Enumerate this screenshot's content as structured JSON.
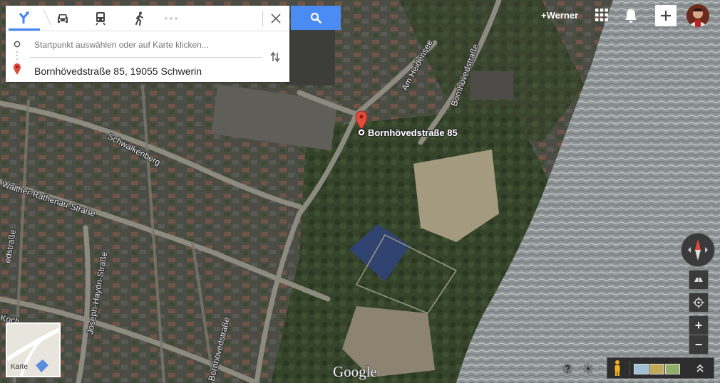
{
  "directions": {
    "modes": [
      {
        "name": "best-route",
        "icon": "route-arrow-icon",
        "active": true
      },
      {
        "name": "car",
        "icon": "car-icon",
        "active": false
      },
      {
        "name": "transit",
        "icon": "train-icon",
        "active": false
      },
      {
        "name": "walking",
        "icon": "walking-icon",
        "active": false
      },
      {
        "name": "more",
        "icon": "more-dots-icon",
        "active": false
      }
    ],
    "start_placeholder": "Startpunkt auswählen oder auf Karte klicken...",
    "destination_value": "Bornhövedstraße 85, 19055 Schwerin",
    "accent_color": "#4285f4",
    "search_button_color": "#4b8bf4"
  },
  "header": {
    "user_label": "+Werner"
  },
  "map": {
    "marker_label": "Bornhövedstraße 85",
    "marker_color": "#e24a3b",
    "street_labels": [
      "Schwalkenberg",
      "Walther-Rathenau-Straße",
      "Am Heidensee",
      "Bornhövedstraße",
      "Bornhövedstraße",
      "Joseph-Haydn-Straße",
      "edstraße",
      "Koch"
    ],
    "attribution": "Google"
  },
  "minimap": {
    "label": "Karte"
  },
  "controls": {
    "zoom_in": "+",
    "zoom_out": "−"
  }
}
